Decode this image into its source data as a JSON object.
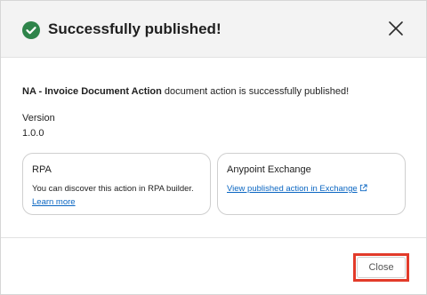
{
  "header": {
    "title": "Successfully published!",
    "success_icon": "check-circle-icon",
    "close_icon": "close-icon"
  },
  "body": {
    "action_name": "NA - Invoice Document Action",
    "message_suffix": " document action is successfully published!",
    "version_label": "Version",
    "version_value": "1.0.0"
  },
  "cards": {
    "rpa": {
      "title": "RPA",
      "text": "You can discover this action in RPA builder. ",
      "link": "Learn more"
    },
    "exchange": {
      "title": "Anypoint Exchange",
      "link": "View published action in Exchange",
      "link_icon": "external-link-icon"
    }
  },
  "footer": {
    "close_label": "Close"
  },
  "colors": {
    "success": "#2e844a",
    "link": "#0a66c2",
    "highlight": "#e23b2a"
  }
}
